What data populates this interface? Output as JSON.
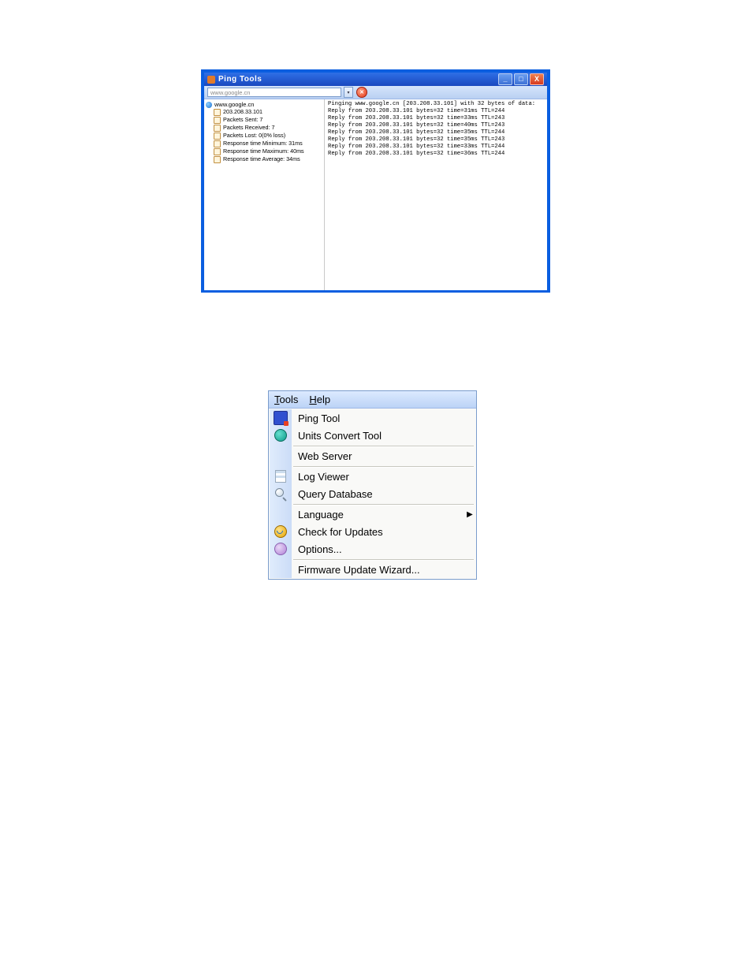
{
  "ping_window": {
    "title": "Ping Tools",
    "buttons": {
      "min": "_",
      "max": "□",
      "close": "X"
    },
    "toolbar": {
      "address": "www.google.cn",
      "dropdown_glyph": "▾",
      "stop_glyph": "✕"
    },
    "tree": {
      "root": "www.google.cn",
      "items": [
        "203.208.33.101",
        "Packets Sent: 7",
        "Packets Received: 7",
        "Packets Lost: 0(0% loss)",
        "Response time Minimum: 31ms",
        "Response time Maximum: 40ms",
        "Response time Average: 34ms"
      ]
    },
    "output": [
      "Pinging www.google.cn [203.208.33.101] with 32 bytes of data:",
      "Reply from 203.208.33.101 bytes=32 time=31ms TTL=244",
      "Reply from 203.208.33.101 bytes=32 time=33ms TTL=243",
      "Reply from 203.208.33.101 bytes=32 time=40ms TTL=243",
      "Reply from 203.208.33.101 bytes=32 time=35ms TTL=244",
      "Reply from 203.208.33.101 bytes=32 time=35ms TTL=243",
      "Reply from 203.208.33.101 bytes=32 time=33ms TTL=244",
      "Reply from 203.208.33.101 bytes=32 time=36ms TTL=244"
    ]
  },
  "tools_menu": {
    "menubar": {
      "tools": "Tools",
      "help": "Help"
    },
    "groups": [
      [
        {
          "icon": "ping-icon",
          "label": "Ping Tool"
        },
        {
          "icon": "units-icon",
          "label": "Units Convert Tool"
        }
      ],
      [
        {
          "icon": "",
          "label": "Web Server"
        }
      ],
      [
        {
          "icon": "log-icon",
          "label": "Log Viewer"
        },
        {
          "icon": "query-icon",
          "label": "Query Database"
        }
      ],
      [
        {
          "icon": "",
          "label": "Language",
          "submenu": true
        },
        {
          "icon": "update-icon",
          "label": "Check for Updates"
        },
        {
          "icon": "options-icon",
          "label": "Options..."
        }
      ],
      [
        {
          "icon": "",
          "label": "Firmware Update Wizard..."
        }
      ]
    ],
    "arrow_glyph": "▶"
  }
}
